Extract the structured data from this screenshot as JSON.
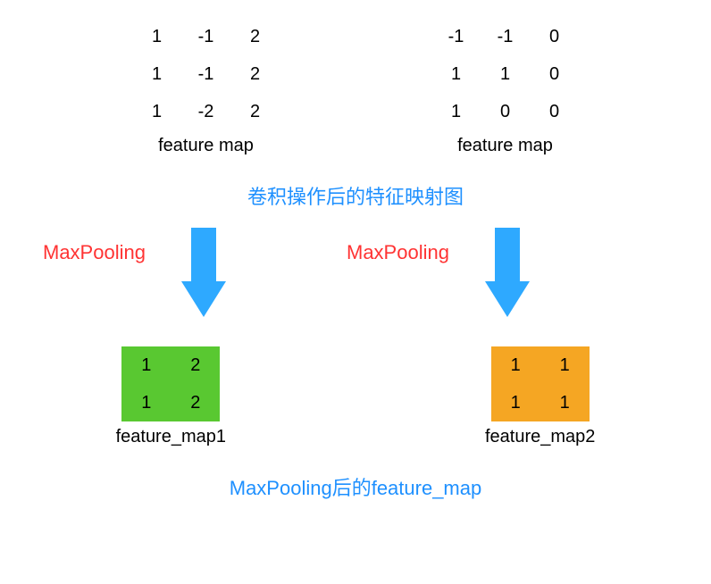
{
  "input_matrices": [
    {
      "values": [
        [
          "1",
          "-1",
          "2"
        ],
        [
          "1",
          "-1",
          "2"
        ],
        [
          "1",
          "-2",
          "2"
        ]
      ],
      "label": "feature map"
    },
    {
      "values": [
        [
          "-1",
          "-1",
          "0"
        ],
        [
          "1",
          "1",
          "0"
        ],
        [
          "1",
          "0",
          "0"
        ]
      ],
      "label": "feature map"
    }
  ],
  "caption_conv": "卷积操作后的特征映射图",
  "operation_label": "MaxPooling",
  "output_matrices": [
    {
      "values": [
        [
          "1",
          "2"
        ],
        [
          "1",
          "2"
        ]
      ],
      "label": "feature_map1",
      "bg_class": "bg-green"
    },
    {
      "values": [
        [
          "1",
          "1"
        ],
        [
          "1",
          "1"
        ]
      ],
      "label": "feature_map2",
      "bg_class": "bg-orange"
    }
  ],
  "caption_pooled": "MaxPooling后的feature_map",
  "chart_data": {
    "type": "table",
    "title": "MaxPooling operation on feature maps",
    "inputs": [
      {
        "name": "feature map",
        "grid": [
          [
            1,
            -1,
            2
          ],
          [
            1,
            -1,
            2
          ],
          [
            1,
            -2,
            2
          ]
        ]
      },
      {
        "name": "feature map",
        "grid": [
          [
            -1,
            -1,
            0
          ],
          [
            1,
            1,
            0
          ],
          [
            1,
            0,
            0
          ]
        ]
      }
    ],
    "operation": "MaxPooling",
    "outputs": [
      {
        "name": "feature_map1",
        "grid": [
          [
            1,
            2
          ],
          [
            1,
            2
          ]
        ]
      },
      {
        "name": "feature_map2",
        "grid": [
          [
            1,
            1
          ],
          [
            1,
            1
          ]
        ]
      }
    ],
    "captions": {
      "after_conv": "卷积操作后的特征映射图",
      "after_pool": "MaxPooling后的feature_map"
    }
  }
}
